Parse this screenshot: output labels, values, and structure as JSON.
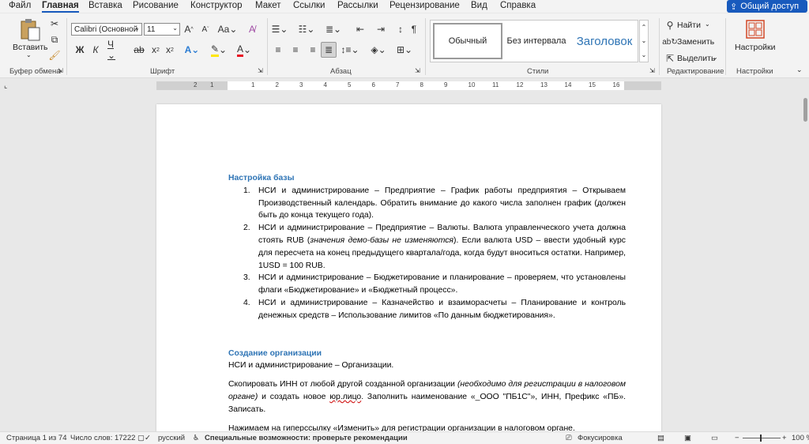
{
  "menu": {
    "tabs": [
      {
        "label": "Файл"
      },
      {
        "label": "Главная"
      },
      {
        "label": "Вставка"
      },
      {
        "label": "Рисование"
      },
      {
        "label": "Конструктор"
      },
      {
        "label": "Макет"
      },
      {
        "label": "Ссылки"
      },
      {
        "label": "Рассылки"
      },
      {
        "label": "Рецензирование"
      },
      {
        "label": "Вид"
      },
      {
        "label": "Справка"
      }
    ],
    "share_label": "Общий доступ"
  },
  "ribbon": {
    "clipboard": {
      "paste_label": "Вставить",
      "group_label": "Буфер обмена"
    },
    "font": {
      "font_name": "Calibri (Основной",
      "font_size": "11",
      "group_label": "Шрифт"
    },
    "paragraph": {
      "group_label": "Абзац"
    },
    "styles": {
      "items": [
        "Обычный",
        "Без интервала",
        "Заголовок"
      ],
      "group_label": "Стили"
    },
    "editing": {
      "find_label": "Найти",
      "replace_label": "Заменить",
      "select_label": "Выделить",
      "group_label": "Редактирование"
    },
    "settings": {
      "label": "Настройки",
      "group_label": "Настройки"
    }
  },
  "ruler": {
    "numbers": [
      "2",
      "1",
      "1",
      "2",
      "3",
      "4",
      "5",
      "6",
      "7",
      "8",
      "9",
      "10",
      "11",
      "12",
      "13",
      "14",
      "15",
      "16"
    ]
  },
  "document": {
    "heading1": "Настройка базы",
    "list": [
      {
        "num": "1.",
        "text": "НСИ и администрирование – Предприятие – График работы предприятия – Открываем Производственный календарь. Обратить внимание до какого числа заполнен график (должен быть до конца текущего года)."
      },
      {
        "num": "2.",
        "text_a": "НСИ и администрирование – Предприятие – Валюты. Валюта управленческого учета должна стоять RUB (",
        "text_italic": "значения демо-базы не изменяются",
        "text_b": "). Если валюта USD – ввести удобный курс для пересчета на конец предыдущего квартала/года, когда будут вноситься остатки. Например, 1USD = 100 RUB."
      },
      {
        "num": "3.",
        "text": "НСИ и администрирование – Бюджетирование и планирование – проверяем, что установлены флаги «Бюджетирование» и «Бюджетный процесс»."
      },
      {
        "num": "4.",
        "text": "НСИ и администрирование – Казначейство и взаиморасчеты – Планирование и контроль денежных средств – Использование лимитов «По данным бюджетирования»."
      }
    ],
    "heading2": "Создание организации",
    "para1": "НСИ и администрирование – Организации.",
    "para2_a": "Скопировать ИНН от любой другой созданной организации ",
    "para2_italic": "(необходимо для регистрации в налоговом органе)",
    "para2_b": " и создать новое ",
    "para2_squig": "юр.лицо",
    "para2_c": ". Заполнить наименование «_ООО \"ПБ1С\"», ИНН, Префикс «ПБ». Записать.",
    "para3": "Нажимаем на гиперссылку «Изменить» для регистрации организации в налоговом органе."
  },
  "status": {
    "page": "Страница 1 из 74",
    "words": "Число слов: 17222",
    "language": "русский",
    "accessibility": "Специальные возможности: проверьте рекомендации",
    "focus": "Фокусировка",
    "zoom": "100 %"
  },
  "colors": {
    "accent": "#185abd",
    "heading": "#2e74b5",
    "font_red": "#e81123",
    "highlight_yellow": "#ffe600"
  }
}
